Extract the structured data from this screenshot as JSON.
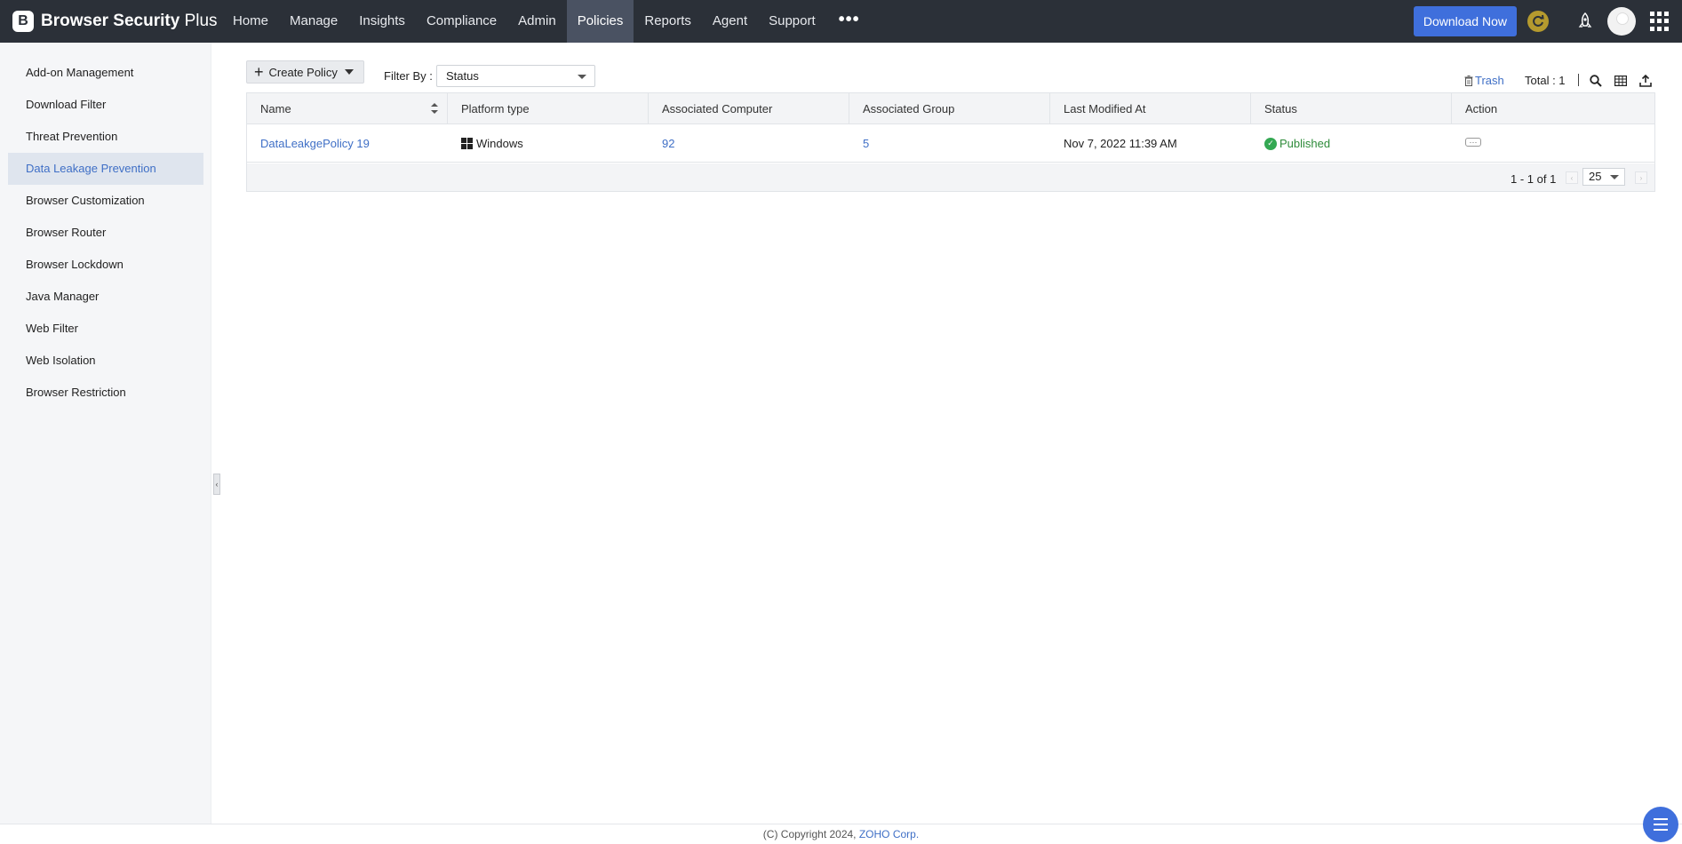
{
  "header": {
    "brand_initial": "B",
    "brand_name_bold": "Browser Security",
    "brand_name_light": " Plus",
    "nav": [
      "Home",
      "Manage",
      "Insights",
      "Compliance",
      "Admin",
      "Policies",
      "Reports",
      "Agent",
      "Support"
    ],
    "active_nav": "Policies",
    "more_label": "•••",
    "download_label": "Download Now",
    "accent_color": "#3f6fdc"
  },
  "sidebar": {
    "items": [
      {
        "label": "Add-on Management"
      },
      {
        "label": "Download Filter"
      },
      {
        "label": "Threat Prevention"
      },
      {
        "label": "Data Leakage Prevention",
        "active": true
      },
      {
        "label": "Browser Customization"
      },
      {
        "label": "Browser Router"
      },
      {
        "label": "Browser Lockdown"
      },
      {
        "label": "Java Manager"
      },
      {
        "label": "Web Filter"
      },
      {
        "label": "Web Isolation"
      },
      {
        "label": "Browser Restriction"
      }
    ]
  },
  "toolbar": {
    "create_label": "Create Policy",
    "filter_label": "Filter By :",
    "filter_value": "Status",
    "trash_label": "Trash",
    "total_label": "Total : 1"
  },
  "table": {
    "columns": [
      "Name",
      "Platform type",
      "Associated Computer",
      "Associated Group",
      "Last Modified At",
      "Status",
      "Action"
    ],
    "rows": [
      {
        "name": "DataLeakgePolicy 19",
        "platform": "Windows",
        "computers": "92",
        "groups": "5",
        "modified": "Nov 7, 2022 11:39 AM",
        "status": "Published"
      }
    ],
    "pager_text": "1 - 1 of 1",
    "per_page": "25"
  },
  "footer": {
    "copyright": "(C) Copyright 2024, ",
    "company": "ZOHO Corp."
  }
}
